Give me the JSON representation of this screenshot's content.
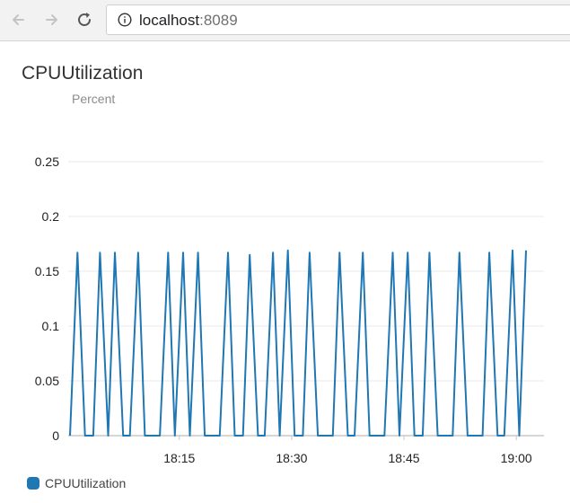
{
  "browser": {
    "url_host": "localhost",
    "url_port": ":8089"
  },
  "icons": {
    "back": "back-arrow-icon",
    "forward": "forward-arrow-icon",
    "reload": "reload-icon",
    "info": "info-icon"
  },
  "colors": {
    "series": "#1f77b4",
    "grid": "#e8e8e8",
    "axis": "#c8c8c8"
  },
  "chart_data": {
    "type": "line",
    "title": "CPUUtilization",
    "subtitle": "Percent",
    "ylim": [
      0,
      0.25
    ],
    "y_ticks": [
      "0",
      "0.05",
      "0.1",
      "0.15",
      "0.2",
      "0.25"
    ],
    "x_ticks": [
      "18:15",
      "18:30",
      "18:45",
      "19:00"
    ],
    "x_tick_values": [
      15,
      30,
      45,
      60
    ],
    "xlim": [
      0.4,
      61.3
    ],
    "grid": true,
    "legend_position": "bottom-left",
    "series": [
      {
        "name": "CPUUtilization",
        "x": [
          0.4,
          1.4,
          2.4,
          3.5,
          4.4,
          5.5,
          6.4,
          7.5,
          8.4,
          9.5,
          10.4,
          11.5,
          12.4,
          13.5,
          14.4,
          15.5,
          16.4,
          17.5,
          18.4,
          19.5,
          20.4,
          21.5,
          22.4,
          23.5,
          24.4,
          25.5,
          26.4,
          27.5,
          28.4,
          29.5,
          30.4,
          31.5,
          32.4,
          33.5,
          34.4,
          35.5,
          36.4,
          37.5,
          38.4,
          39.5,
          40.4,
          41.5,
          42.4,
          43.5,
          44.4,
          45.5,
          46.4,
          47.5,
          48.4,
          49.5,
          50.4,
          51.5,
          52.4,
          53.5,
          54.4,
          55.5,
          56.4,
          57.5,
          58.4,
          59.5,
          60.4,
          61.3
        ],
        "y": [
          0,
          0.167,
          0,
          0,
          0.167,
          0,
          0.167,
          0,
          0,
          0.167,
          0,
          0,
          0,
          0.167,
          0,
          0.167,
          0,
          0.167,
          0,
          0,
          0,
          0.167,
          0,
          0,
          0.165,
          0,
          0,
          0.167,
          0,
          0.169,
          0,
          0,
          0.167,
          0,
          0,
          0,
          0.167,
          0,
          0,
          0.167,
          0,
          0,
          0,
          0.167,
          0,
          0.167,
          0,
          0,
          0.167,
          0,
          0,
          0,
          0.167,
          0,
          0,
          0,
          0.167,
          0,
          0,
          0.169,
          0,
          0.169
        ]
      }
    ]
  },
  "legend": {
    "label": "CPUUtilization"
  }
}
